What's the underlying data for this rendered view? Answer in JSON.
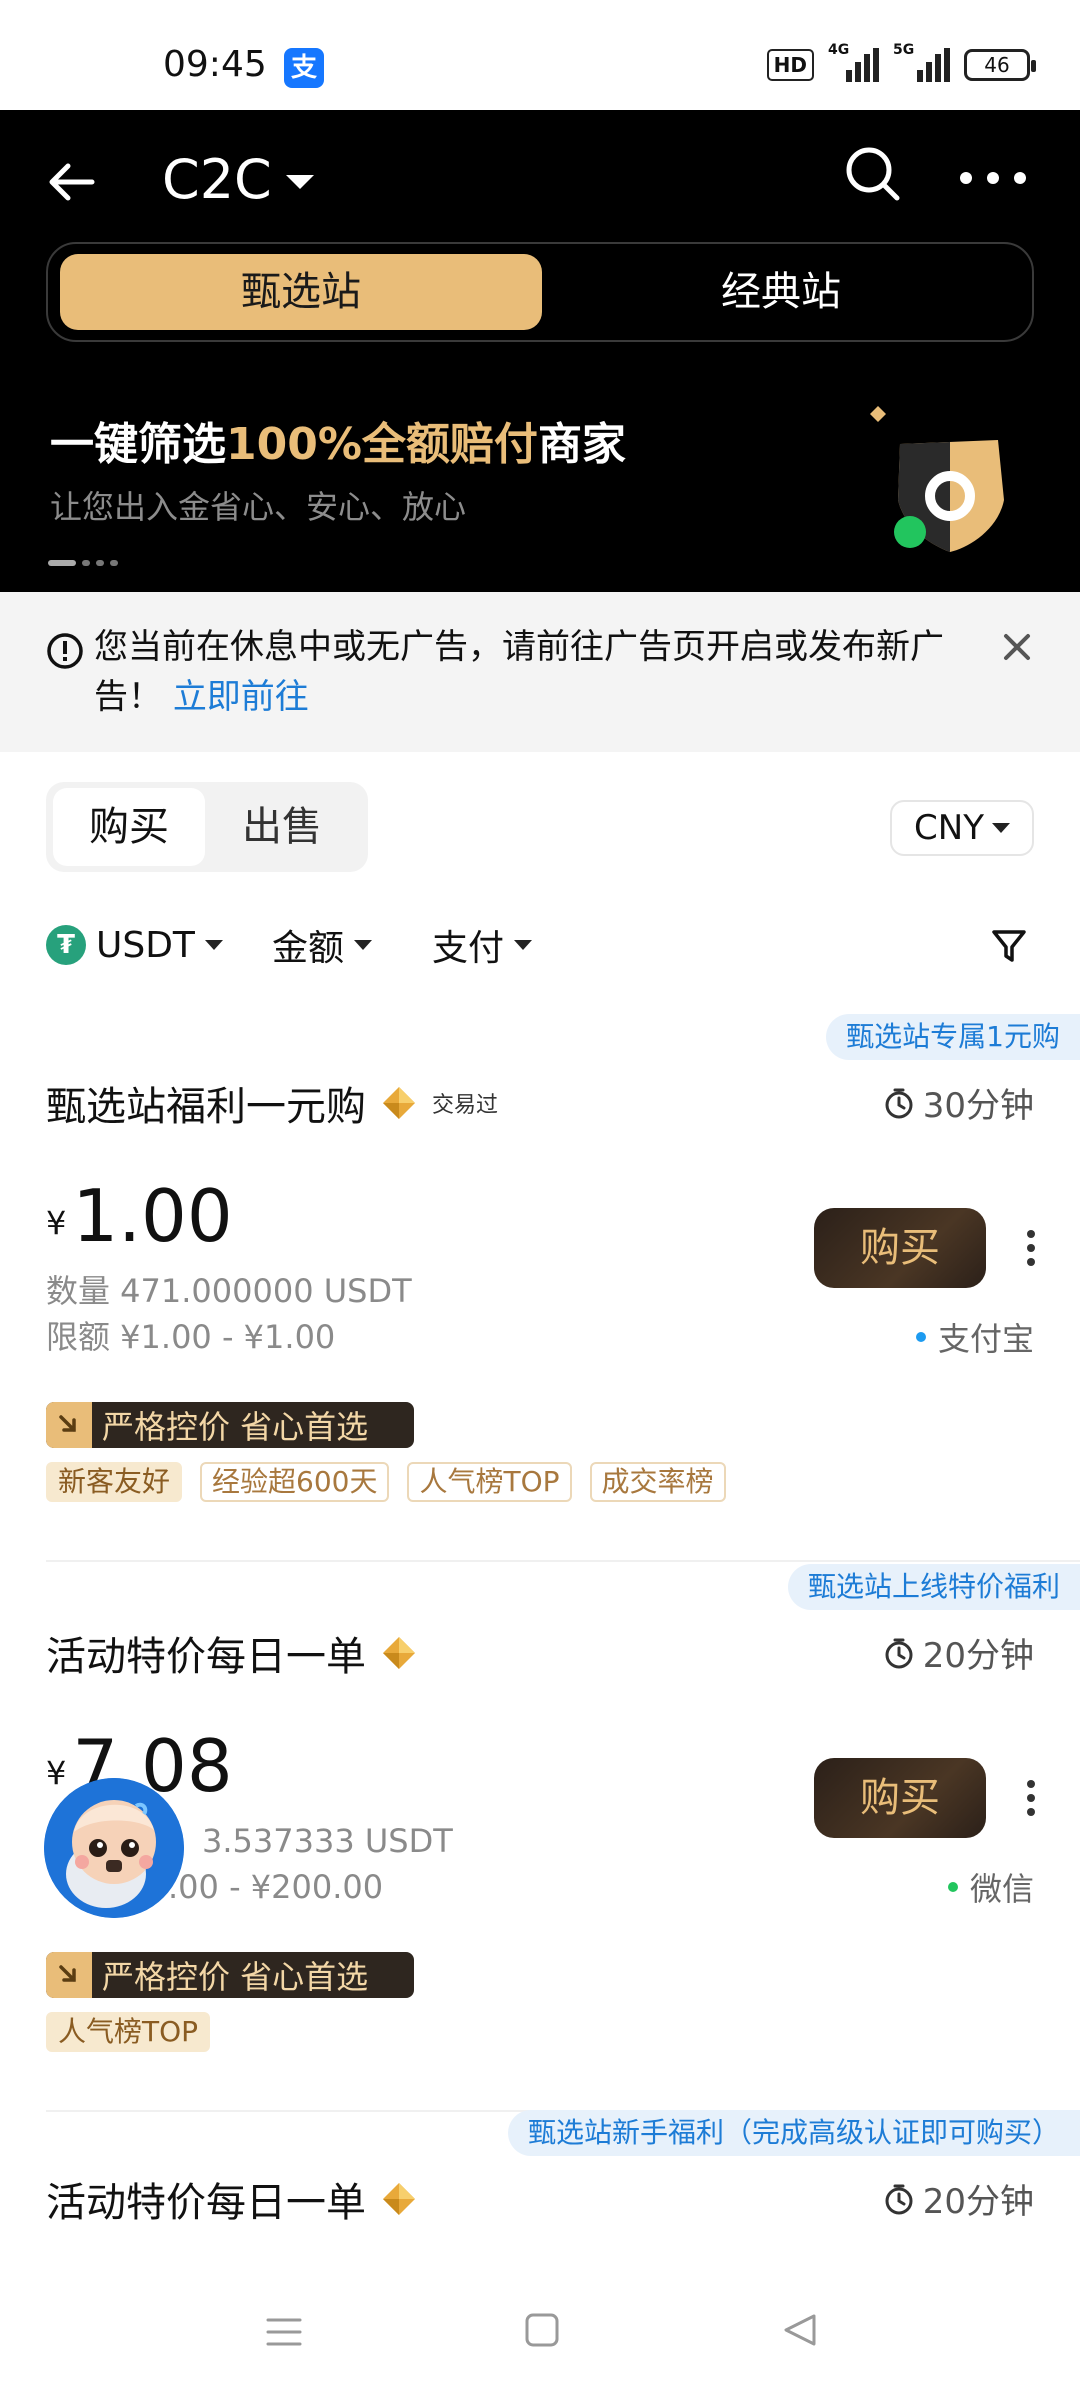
{
  "status_bar": {
    "time": "09:45",
    "app_icon_glyph": "支",
    "hd": "HD",
    "net1": "4G",
    "net2": "5G",
    "battery": "46"
  },
  "header": {
    "title": "C2C",
    "segments": [
      "甄选站",
      "经典站"
    ],
    "active_segment": 0
  },
  "banner": {
    "title_pre": "一键筛选",
    "title_highlight": "100%全额赔付",
    "title_post": "商家",
    "subtitle": "让您出入金省心、安心、放心"
  },
  "notice": {
    "text": "您当前在休息中或无广告，请前往广告页开启或发布新广告！",
    "link": "立即前往"
  },
  "trade_toggle": {
    "buy": "购买",
    "sell": "出售"
  },
  "currency": "CNY",
  "filters": {
    "coin": "USDT",
    "amount": "金额",
    "payment": "支付"
  },
  "listings": [
    {
      "promo": "甄选站专属1元购",
      "merchant": "甄选站福利一元购",
      "traded_badge": "交易过",
      "time_limit": "30分钟",
      "currency_symbol": "¥",
      "price": "1.00",
      "quantity": "数量 471.000000 USDT",
      "limit": "限额 ¥1.00 - ¥1.00",
      "buy_label": "购买",
      "payment": "支付宝",
      "payment_color": "#1d9bf0",
      "feature": "严格控价 省心首选",
      "tags": [
        "新客友好",
        "经验超600天",
        "人气榜TOP",
        "成交率榜"
      ]
    },
    {
      "promo": "甄选站上线特价福利",
      "merchant": "活动特价每日一单",
      "time_limit": "20分钟",
      "currency_symbol": "¥",
      "price": "7.08",
      "quantity": "3.537333 USDT",
      "limit": ".00 - ¥200.00",
      "buy_label": "购买",
      "payment": "微信",
      "payment_color": "#22c55e",
      "feature": "严格控价 省心首选",
      "tags": [
        "人气榜TOP"
      ]
    },
    {
      "promo": "甄选站新手福利（完成高级认证即可购买）",
      "merchant": "活动特价每日一单",
      "time_limit": "20分钟"
    }
  ],
  "colors": {
    "gold": "#e9bd79",
    "link_blue": "#1d7cd6",
    "header_bg": "#000000"
  }
}
